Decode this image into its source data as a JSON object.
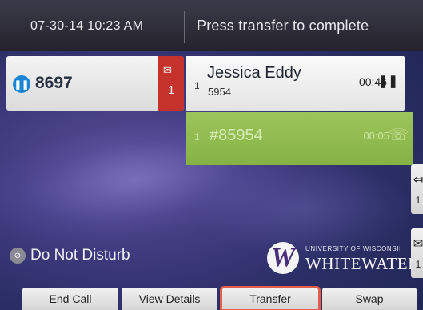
{
  "header": {
    "datetime": "07-30-14 10:23 AM",
    "status": "Press transfer to complete"
  },
  "line": {
    "icon": "pause-icon",
    "number": "8697",
    "voicemail_icon": "voicemail-icon",
    "voicemail_count": "1"
  },
  "calls": [
    {
      "index": "1",
      "name": "Jessica Eddy",
      "sub": "5954",
      "duration": "00:46",
      "state_icon": "hold-icon",
      "state_glyph": "❚❚"
    },
    {
      "index": "1",
      "name": "#85954",
      "duration": "00:05",
      "state_icon": "handset-icon",
      "state_glyph": "☏"
    }
  ],
  "side_tabs": [
    {
      "icon": "transfer-arrow-icon",
      "glyph": "⤆",
      "count": "1"
    },
    {
      "icon": "voicemail-icon",
      "glyph": "✉",
      "count": "1"
    }
  ],
  "dnd": {
    "icon": "dnd-icon",
    "label": "Do Not Disturb"
  },
  "logo": {
    "small": "UNIVERSITY OF WISCONSIN",
    "big": "WHITEWATER",
    "mark": "W"
  },
  "softkeys": [
    "End Call",
    "View Details",
    "Transfer",
    "Swap"
  ],
  "colors": {
    "voicemail_badge": "#c5322b",
    "active_call": "#92bc50",
    "highlight": "#e35d4a",
    "line_icon": "#1c86d6"
  }
}
